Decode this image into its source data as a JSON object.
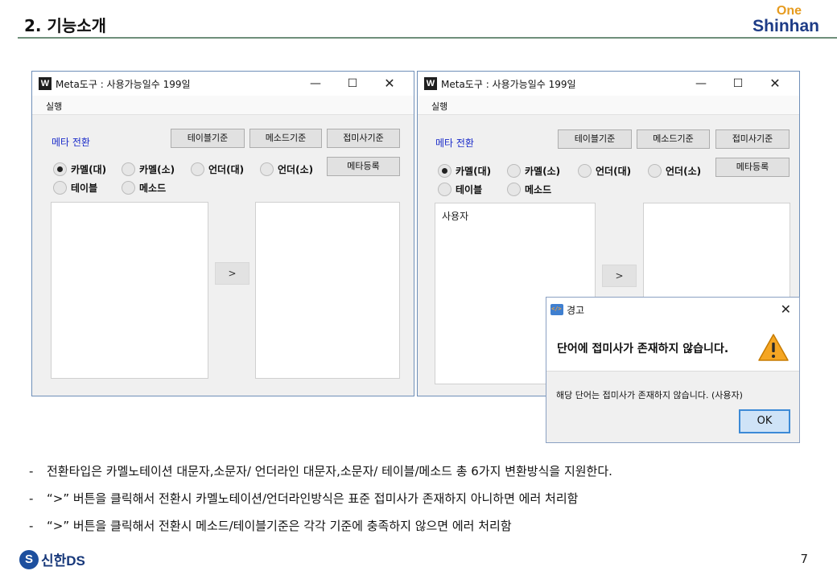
{
  "slide": {
    "title": "2. 기능소개",
    "logo_one": "One",
    "logo_shinhan": "Shinhan",
    "bottom_logo": "신한DS",
    "page_number": "7"
  },
  "app_window": {
    "icon_letter": "W",
    "title": "Meta도구 : 사용가능일수 199일",
    "controls": {
      "minimize": "—",
      "maximize": "☐",
      "close": "✕"
    },
    "menu": [
      "실행"
    ],
    "meta_label": "메타 전환",
    "buttons": {
      "table_basis": "테이블기준",
      "method_basis": "메소드기준",
      "suffix_basis": "접미사기준",
      "register_meta": "메타등록",
      "convert_arrow": ">"
    },
    "radio_options": [
      "카멜(대)",
      "카멜(소)",
      "언더(대)",
      "언더(소)",
      "테이블",
      "메소드"
    ],
    "selected_option": "카멜(대)"
  },
  "window_left": {
    "input_text": "",
    "output_text": ""
  },
  "window_right": {
    "input_text": "사용자",
    "output_text": ""
  },
  "dialog": {
    "title": "경고",
    "close": "✕",
    "heading": "단어에 접미사가 존재하지 않습니다.",
    "detail": "해당 단어는 접미사가 존재하지 않습니다. (사용자)",
    "ok": "OK",
    "icon": "warning-icon"
  },
  "bullets": [
    "전환타입은 카멜노테이션 대문자,소문자/ 언더라인 대문자,소문자/ 테이블/메소드 총 6가지 변환방식을 지원한다.",
    "“>” 버튼을 클릭해서 전환시  카멜노테이션/언더라인방식은 표준 접미사가 존재하지 아니하면 에러 처리함",
    "“>” 버튼을 클릭해서 전환시  메소드/테이블기준은 각각 기준에 충족하지 않으면 에러 처리함"
  ],
  "bullet_dash": "-",
  "colors": {
    "meta_label": "#1a2bc9",
    "logo_one": "#e69b1f",
    "logo_shinhan": "#1d3b86",
    "ok_border": "#3c8ad6"
  }
}
